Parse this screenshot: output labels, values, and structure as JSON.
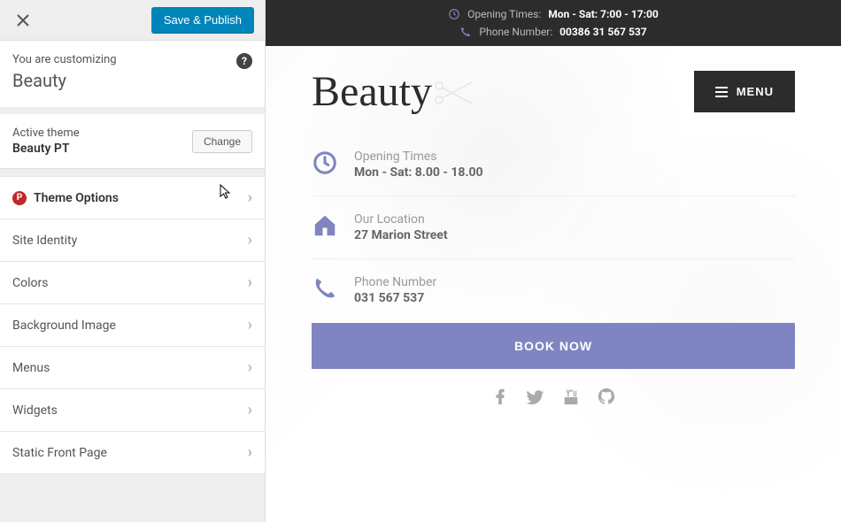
{
  "sidebar": {
    "save_label": "Save & Publish",
    "customizing_label": "You are customizing",
    "site_title": "Beauty",
    "active_theme_label": "Active theme",
    "active_theme_name": "Beauty PT",
    "change_label": "Change",
    "items": [
      {
        "label": "Theme Options",
        "icon": "P",
        "bold": true
      },
      {
        "label": "Site Identity"
      },
      {
        "label": "Colors"
      },
      {
        "label": "Background Image"
      },
      {
        "label": "Menus"
      },
      {
        "label": "Widgets"
      },
      {
        "label": "Static Front Page"
      }
    ]
  },
  "preview": {
    "topbar": {
      "opening_label": "Opening Times:",
      "opening_value": "Mon - Sat: 7:00 - 17:00",
      "phone_label": "Phone Number:",
      "phone_value": "00386 31 567 537"
    },
    "logo_text": "Beauty",
    "menu_btn": "MENU",
    "info": [
      {
        "label": "Opening Times",
        "value": "Mon - Sat: 8.00 - 18.00"
      },
      {
        "label": "Our Location",
        "value": "27 Marion Street"
      },
      {
        "label": "Phone Number",
        "value": "031 567 537"
      }
    ],
    "book_btn": "BOOK NOW"
  },
  "colors": {
    "accent": "#8085c1",
    "dark": "#2c2c2c",
    "save": "#0085ba"
  }
}
